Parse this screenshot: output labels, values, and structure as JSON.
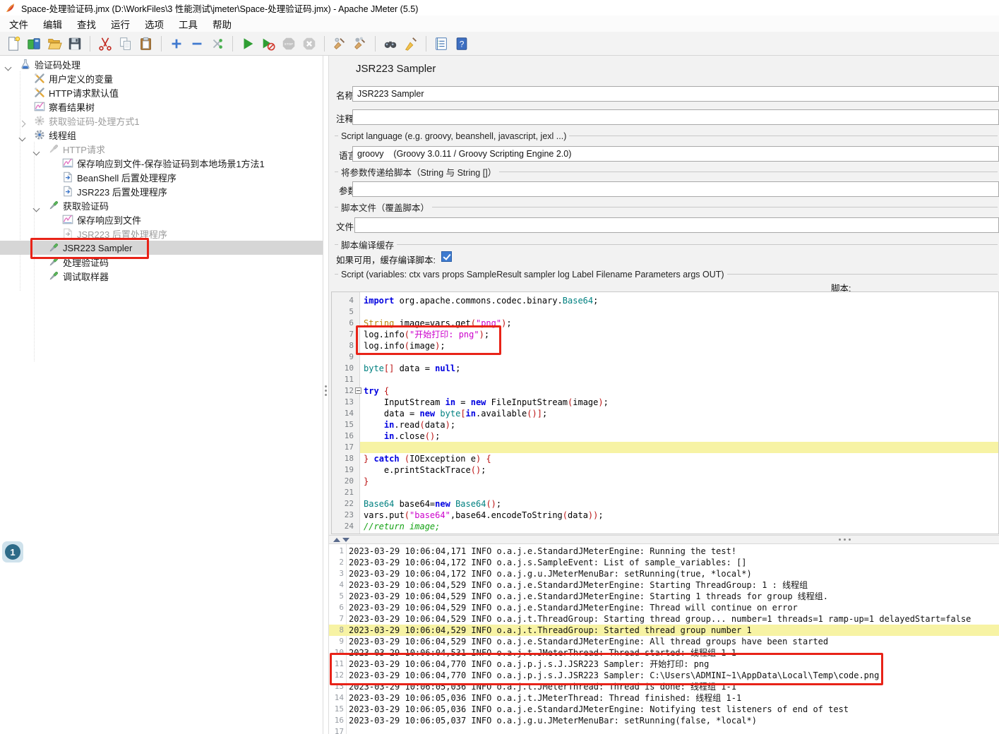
{
  "window": {
    "title": "Space-处理验证码.jmx (D:\\WorkFiles\\3 性能测试\\jmeter\\Space-处理验证码.jmx) - Apache JMeter (5.5)"
  },
  "menu": {
    "items": [
      "文件",
      "编辑",
      "查找",
      "运行",
      "选项",
      "工具",
      "帮助"
    ]
  },
  "toolbar": {
    "items": [
      "new",
      "templates",
      "open",
      "save",
      "|",
      "cut",
      "copy",
      "paste",
      "|",
      "expand-all",
      "collapse-all",
      "toggle",
      "|",
      "start",
      "start-no-timers",
      "stop",
      "shutdown",
      "|",
      "clear",
      "clear-all",
      "|",
      "search",
      "reset-search",
      "|",
      "function-helper",
      "help"
    ]
  },
  "tree": {
    "items": [
      {
        "label": "验证码处理",
        "icon": "flask",
        "level": 0,
        "expander": "expanded",
        "disabled": false,
        "selected": false
      },
      {
        "label": "用户定义的变量",
        "icon": "tools",
        "level": 1,
        "expander": null,
        "disabled": false,
        "selected": false
      },
      {
        "label": "HTTP请求默认值",
        "icon": "tools",
        "level": 1,
        "expander": null,
        "disabled": false,
        "selected": false
      },
      {
        "label": "察看结果树",
        "icon": "chart",
        "level": 1,
        "expander": null,
        "disabled": false,
        "selected": false
      },
      {
        "label": "获取验证码-处理方式1",
        "icon": "gear",
        "level": 1,
        "expander": "collapsed",
        "disabled": true,
        "selected": false
      },
      {
        "label": "线程组",
        "icon": "gear",
        "level": 1,
        "expander": "expanded",
        "disabled": false,
        "selected": false
      },
      {
        "label": "HTTP请求",
        "icon": "sampler",
        "level": 2,
        "expander": "expanded",
        "disabled": true,
        "selected": false
      },
      {
        "label": "保存响应到文件-保存验证码到本地场景1方法1",
        "icon": "chart",
        "level": 3,
        "expander": null,
        "disabled": false,
        "selected": false
      },
      {
        "label": "BeanShell 后置处理程序",
        "icon": "doc-arrow",
        "level": 3,
        "expander": null,
        "disabled": false,
        "selected": false
      },
      {
        "label": "JSR223 后置处理程序",
        "icon": "doc-arrow",
        "level": 3,
        "expander": null,
        "disabled": false,
        "selected": false
      },
      {
        "label": "获取验证码",
        "icon": "sampler",
        "level": 2,
        "expander": "expanded",
        "disabled": false,
        "selected": false
      },
      {
        "label": "保存响应到文件",
        "icon": "chart",
        "level": 3,
        "expander": null,
        "disabled": false,
        "selected": false
      },
      {
        "label": "JSR223 后置处理程序",
        "icon": "doc-arrow",
        "level": 3,
        "expander": null,
        "disabled": true,
        "selected": false
      },
      {
        "label": "JSR223 Sampler",
        "icon": "sampler",
        "level": 2,
        "expander": null,
        "disabled": false,
        "selected": true
      },
      {
        "label": "处理验证码",
        "icon": "sampler",
        "level": 2,
        "expander": null,
        "disabled": false,
        "selected": false
      },
      {
        "label": "调试取样器",
        "icon": "sampler",
        "level": 2,
        "expander": null,
        "disabled": false,
        "selected": false
      }
    ]
  },
  "panel": {
    "title": "JSR223 Sampler",
    "name_label": "名称:",
    "name_value": "JSR223 Sampler",
    "comment_label": "注释:",
    "comment_value": "",
    "group_script_language": "Script language (e.g. groovy, beanshell, javascript, jexl ...)",
    "language_label": "语言:",
    "language_value": "groovy    (Groovy 3.0.11 / Groovy Scripting Engine 2.0)",
    "group_parameters": "将参数传递给脚本（String 与 String []）",
    "params_label": "参数:",
    "params_value": "",
    "group_script_file": "脚本文件（覆盖脚本）",
    "filename_label": "文件名:",
    "filename_value": "",
    "group_cache": "脚本编译缓存",
    "cache_label": "如果可用，缓存编译脚本:",
    "cache_checked": true,
    "group_script": "Script (variables: ctx vars props SampleResult sampler log Label Filename Parameters args OUT)",
    "script_label": "脚本:"
  },
  "editor": {
    "highlight_line": 17,
    "fold_line": 12,
    "lines": [
      {
        "n": 4,
        "t": [
          [
            "kw",
            "import"
          ],
          [
            "pl",
            " org.apache.commons.codec.binary."
          ],
          [
            "ty2",
            "Base64"
          ],
          [
            "pl",
            ";"
          ]
        ]
      },
      {
        "n": 5,
        "t": []
      },
      {
        "n": 6,
        "t": [
          [
            "ty1",
            "String"
          ],
          [
            "pl",
            " image=vars.get"
          ],
          [
            "sep",
            "("
          ],
          [
            "str",
            "\"png\""
          ],
          [
            "sep",
            ")"
          ],
          [
            "pl",
            ";"
          ]
        ]
      },
      {
        "n": 7,
        "t": [
          [
            "pl",
            "log.info"
          ],
          [
            "sep",
            "("
          ],
          [
            "str",
            "\"开始打印: png\""
          ],
          [
            "sep",
            ")"
          ],
          [
            "pl",
            ";"
          ]
        ]
      },
      {
        "n": 8,
        "t": [
          [
            "pl",
            "log.info"
          ],
          [
            "sep",
            "("
          ],
          [
            "pl",
            "image"
          ],
          [
            "sep",
            ")"
          ],
          [
            "pl",
            ";"
          ]
        ]
      },
      {
        "n": 9,
        "t": []
      },
      {
        "n": 10,
        "t": [
          [
            "ty2",
            "byte"
          ],
          [
            "sep",
            "[]"
          ],
          [
            "pl",
            " data = "
          ],
          [
            "kw",
            "null"
          ],
          [
            "pl",
            ";"
          ]
        ]
      },
      {
        "n": 11,
        "t": []
      },
      {
        "n": 12,
        "t": [
          [
            "kw",
            "try"
          ],
          [
            "pl",
            " "
          ],
          [
            "sep",
            "{"
          ]
        ]
      },
      {
        "n": 13,
        "t": [
          [
            "pl",
            "    InputStream "
          ],
          [
            "kw",
            "in"
          ],
          [
            "pl",
            " = "
          ],
          [
            "kw",
            "new"
          ],
          [
            "pl",
            " FileInputStream"
          ],
          [
            "sep",
            "("
          ],
          [
            "pl",
            "image"
          ],
          [
            "sep",
            ")"
          ],
          [
            "pl",
            ";"
          ]
        ]
      },
      {
        "n": 14,
        "t": [
          [
            "pl",
            "    data = "
          ],
          [
            "kw",
            "new"
          ],
          [
            "pl",
            " "
          ],
          [
            "ty2",
            "byte"
          ],
          [
            "sep",
            "["
          ],
          [
            "kw",
            "in"
          ],
          [
            "pl",
            ".available"
          ],
          [
            "sep",
            "()]"
          ],
          [
            "pl",
            ";"
          ]
        ]
      },
      {
        "n": 15,
        "t": [
          [
            "pl",
            "    "
          ],
          [
            "kw",
            "in"
          ],
          [
            "pl",
            ".read"
          ],
          [
            "sep",
            "("
          ],
          [
            "pl",
            "data"
          ],
          [
            "sep",
            ")"
          ],
          [
            "pl",
            ";"
          ]
        ]
      },
      {
        "n": 16,
        "t": [
          [
            "pl",
            "    "
          ],
          [
            "kw",
            "in"
          ],
          [
            "pl",
            ".close"
          ],
          [
            "sep",
            "()"
          ],
          [
            "pl",
            ";"
          ]
        ]
      },
      {
        "n": 17,
        "t": []
      },
      {
        "n": 18,
        "t": [
          [
            "sep",
            "}"
          ],
          [
            "pl",
            " "
          ],
          [
            "kw",
            "catch"
          ],
          [
            "pl",
            " "
          ],
          [
            "sep",
            "("
          ],
          [
            "pl",
            "IOException e"
          ],
          [
            "sep",
            ")"
          ],
          [
            "pl",
            " "
          ],
          [
            "sep",
            "{"
          ]
        ]
      },
      {
        "n": 19,
        "t": [
          [
            "pl",
            "    e.printStackTrace"
          ],
          [
            "sep",
            "()"
          ],
          [
            "pl",
            ";"
          ]
        ]
      },
      {
        "n": 20,
        "t": [
          [
            "sep",
            "}"
          ]
        ]
      },
      {
        "n": 21,
        "t": []
      },
      {
        "n": 22,
        "t": [
          [
            "ty2",
            "Base64"
          ],
          [
            "pl",
            " base64="
          ],
          [
            "kw",
            "new"
          ],
          [
            "pl",
            " "
          ],
          [
            "ty2",
            "Base64"
          ],
          [
            "sep",
            "()"
          ],
          [
            "pl",
            ";"
          ]
        ]
      },
      {
        "n": 23,
        "t": [
          [
            "pl",
            "vars.put"
          ],
          [
            "sep",
            "("
          ],
          [
            "str",
            "\"base64\""
          ],
          [
            "pl",
            ","
          ],
          [
            "pl",
            "base64.encodeToString"
          ],
          [
            "sep",
            "("
          ],
          [
            "pl",
            "data"
          ],
          [
            "sep",
            "))"
          ],
          [
            "pl",
            ";"
          ]
        ]
      },
      {
        "n": 24,
        "t": [
          [
            "com",
            "//return image;"
          ]
        ]
      }
    ]
  },
  "log": {
    "highlight_line": 8,
    "redbox_lines": [
      11,
      12
    ],
    "lines": [
      "2023-03-29 10:06:04,171 INFO o.a.j.e.StandardJMeterEngine: Running the test!",
      "2023-03-29 10:06:04,172 INFO o.a.j.s.SampleEvent: List of sample_variables: []",
      "2023-03-29 10:06:04,172 INFO o.a.j.g.u.JMeterMenuBar: setRunning(true, *local*)",
      "2023-03-29 10:06:04,529 INFO o.a.j.e.StandardJMeterEngine: Starting ThreadGroup: 1 : 线程组",
      "2023-03-29 10:06:04,529 INFO o.a.j.e.StandardJMeterEngine: Starting 1 threads for group 线程组.",
      "2023-03-29 10:06:04,529 INFO o.a.j.e.StandardJMeterEngine: Thread will continue on error",
      "2023-03-29 10:06:04,529 INFO o.a.j.t.ThreadGroup: Starting thread group... number=1 threads=1 ramp-up=1 delayedStart=false",
      "2023-03-29 10:06:04,529 INFO o.a.j.t.ThreadGroup: Started thread group number 1",
      "2023-03-29 10:06:04,529 INFO o.a.j.e.StandardJMeterEngine: All thread groups have been started",
      "2023-03-29 10:06:04,531 INFO o.a.j.t.JMeterThread: Thread started: 线程组 1-1",
      "2023-03-29 10:06:04,770 INFO o.a.j.p.j.s.J.JSR223 Sampler: 开始打印: png",
      "2023-03-29 10:06:04,770 INFO o.a.j.p.j.s.J.JSR223 Sampler: C:\\Users\\ADMINI~1\\AppData\\Local\\Temp\\code.png",
      "2023-03-29 10:06:05,036 INFO o.a.j.t.JMeterThread: Thread is done: 线程组 1-1",
      "2023-03-29 10:06:05,036 INFO o.a.j.t.JMeterThread: Thread finished: 线程组 1-1",
      "2023-03-29 10:06:05,036 INFO o.a.j.e.StandardJMeterEngine: Notifying test listeners of end of test",
      "2023-03-29 10:06:05,037 INFO o.a.j.g.u.JMeterMenuBar: setRunning(false, *local*)",
      ""
    ]
  },
  "annotations": {
    "step_badge": "1"
  },
  "colors": {
    "annotation_red": "#e82318",
    "highlight_yellow": "#f7f3a4",
    "selection_grey": "#d6d6d6",
    "checkbox_blue": "#3d7bd0"
  }
}
